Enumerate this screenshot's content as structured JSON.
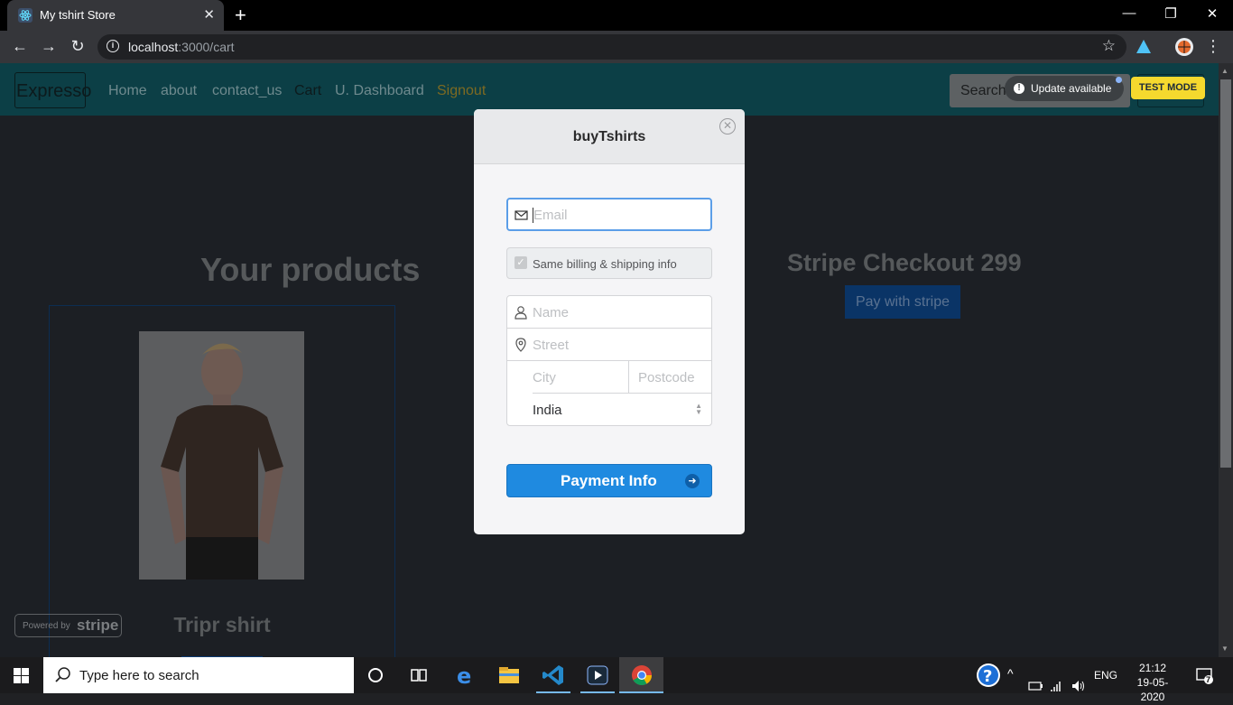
{
  "browser": {
    "tab_title": "My tshirt Store",
    "tab_close": "✕",
    "new_tab": "+",
    "url_host": "localhost",
    "url_path": ":3000/cart",
    "window_controls": [
      "—",
      "❐",
      "✕"
    ]
  },
  "app_nav": {
    "brand": "Expresso",
    "links": [
      "Home",
      "about",
      "contact_us",
      "Cart",
      "U. Dashboard",
      "Signout"
    ],
    "search_placeholder": "Search",
    "update_available": "Update available",
    "test_mode": "TEST MODE"
  },
  "cart": {
    "heading": "Your products",
    "product_name": "Tripr shirt",
    "checkout_heading": "Stripe Checkout 299",
    "pay_button": "Pay with stripe"
  },
  "powered_by": {
    "prefix": "Powered by",
    "brand": "stripe"
  },
  "stripe_modal": {
    "title": "buyTshirts",
    "close": "✕",
    "email_placeholder": "Email",
    "same_billing_label": "Same billing & shipping info",
    "name_placeholder": "Name",
    "street_placeholder": "Street",
    "city_placeholder": "City",
    "postcode_placeholder": "Postcode",
    "country": "India",
    "payment_button": "Payment Info"
  },
  "taskbar": {
    "search_placeholder": "Type here to search",
    "language": "ENG",
    "time": "21:12",
    "date": "19-05-2020",
    "notifications": "7"
  },
  "colors": {
    "stripe_blue": "#1f8ae0",
    "nav_teal": "#0c3f46",
    "test_mode_yellow": "#f5d92e"
  }
}
